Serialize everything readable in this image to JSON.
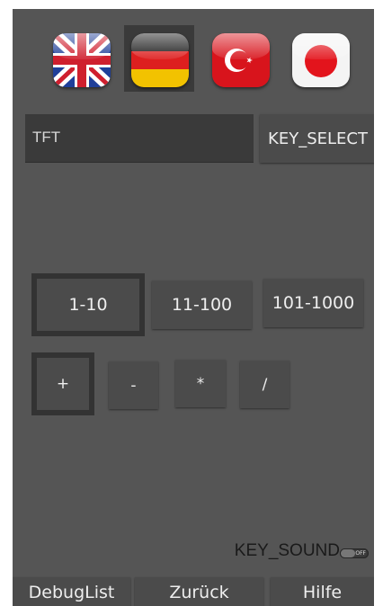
{
  "languages": [
    {
      "name": "uk-flag-icon",
      "selected": false
    },
    {
      "name": "germany-flag-icon",
      "selected": true
    },
    {
      "name": "turkey-flag-icon",
      "selected": false
    },
    {
      "name": "japan-flag-icon",
      "selected": false
    }
  ],
  "tft_field": {
    "value": "TFT"
  },
  "key_select_button": {
    "label": "KEY_SELECT"
  },
  "ranges": [
    {
      "label": "1-10",
      "selected": true
    },
    {
      "label": "11-100",
      "selected": false
    },
    {
      "label": "101-1000",
      "selected": false
    }
  ],
  "operators": [
    {
      "label": "+",
      "selected": true
    },
    {
      "label": "-",
      "selected": false
    },
    {
      "label": "*",
      "selected": false
    },
    {
      "label": "/",
      "selected": false
    }
  ],
  "sound": {
    "label": "KEY_SOUND",
    "toggle_text": "OFF"
  },
  "bottom_bar": {
    "debug": "DebugList",
    "back": "Zurück",
    "help": "Hilfe"
  },
  "colors": {
    "background": "#555555",
    "button": "#4b4b4b",
    "selected_frame": "#333333",
    "text": "#eeeeee"
  }
}
